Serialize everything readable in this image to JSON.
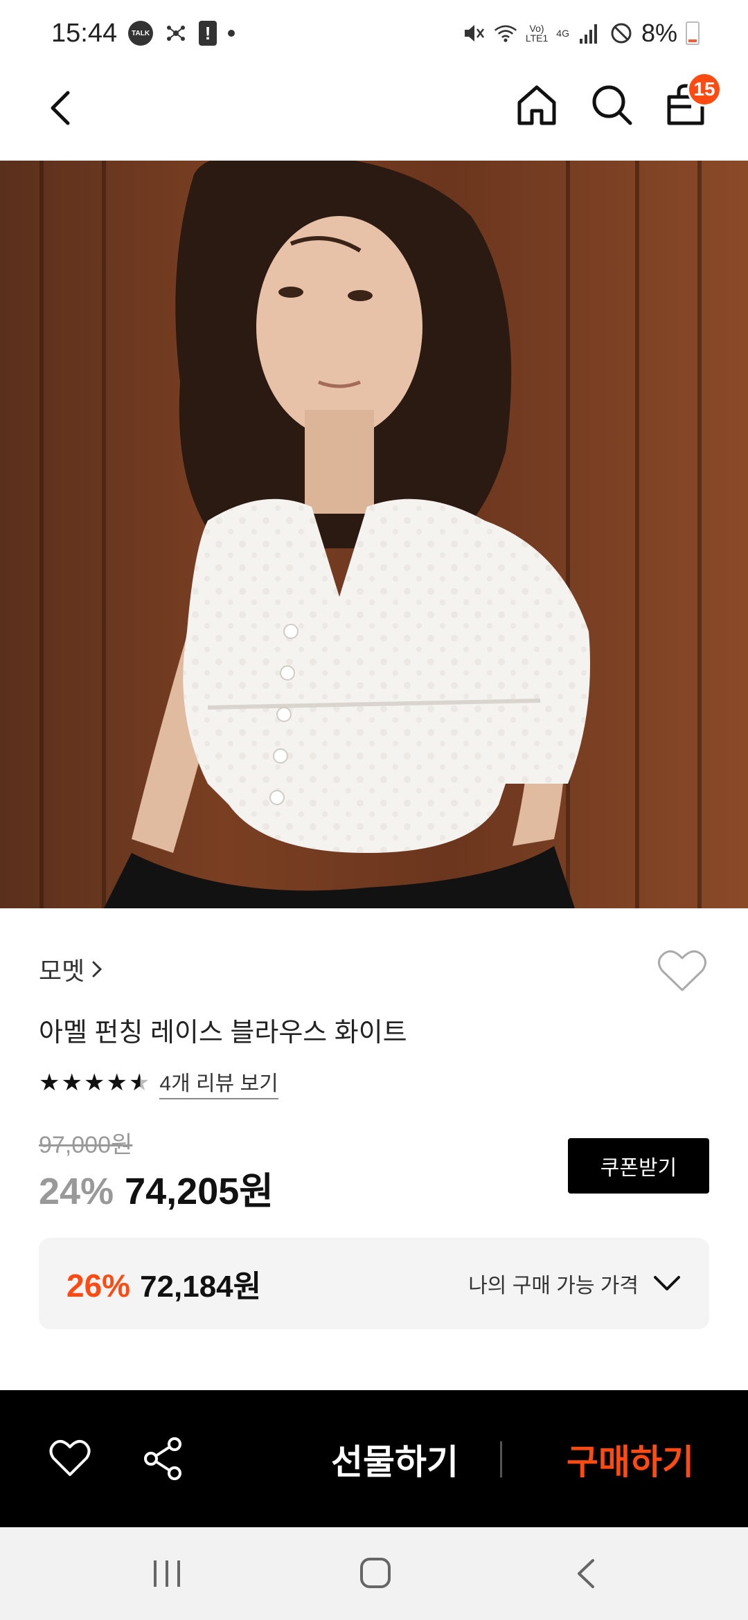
{
  "status_bar": {
    "time": "15:44",
    "talk_label": "TALK",
    "warning_glyph": "!",
    "network_top": "Vo)",
    "network_bottom": "LTE1",
    "network_type": "4G",
    "battery": "8%",
    "icons": [
      "kakaotalk-icon",
      "network-share-icon",
      "warning-icon",
      "mute-icon",
      "wifi-icon",
      "signal-icon",
      "do-not-disturb-icon",
      "battery-icon"
    ]
  },
  "nav": {
    "cart_count": "15",
    "icons": [
      "back-icon",
      "home-icon",
      "search-icon",
      "shopping-bag-icon"
    ]
  },
  "product": {
    "brand": "모멧",
    "name": "아멜 펀칭 레이스 블라우스 화이트",
    "rating": 4.5,
    "review_link": "4개 리뷰 보기",
    "original_price": "97,000원",
    "discount_rate": "24%",
    "sale_price": "74,205원",
    "coupon_button": "쿠폰받기",
    "my_price": {
      "rate": "26%",
      "price": "72,184원",
      "label": "나의 구매 가능 가격"
    }
  },
  "action_bar": {
    "gift_label": "선물하기",
    "buy_label": "구매하기"
  },
  "colors": {
    "accent": "#ff4a12",
    "action_bar_bg": "#000000",
    "my_price_bg": "#f4f4f4"
  }
}
